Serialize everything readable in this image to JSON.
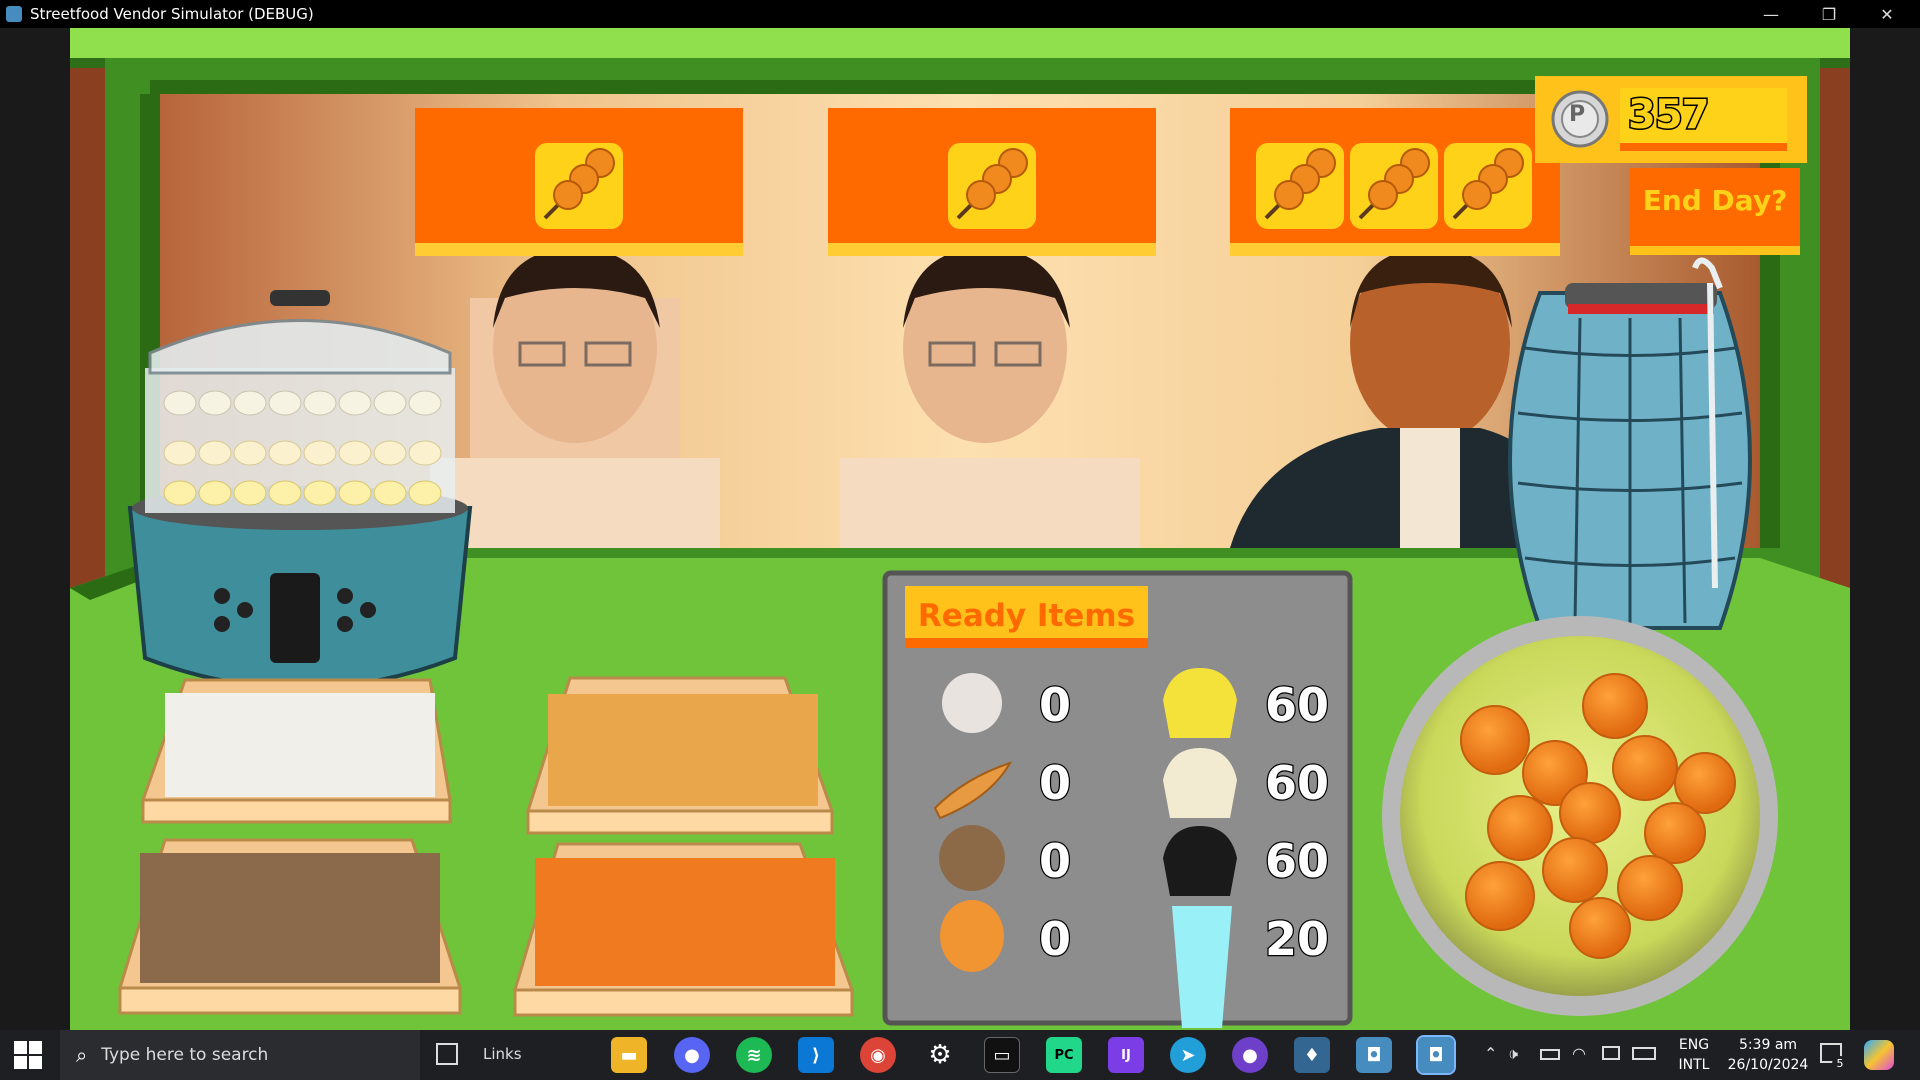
{
  "window": {
    "title": "Streetfood Vendor Simulator (DEBUG)",
    "minimize": "—",
    "maximize": "❐",
    "close": "✕"
  },
  "hud": {
    "coins": "357",
    "coin_symbol": "P",
    "end_day_label": "End Day?"
  },
  "orders": [
    {
      "item": "fishball-skewer",
      "count": 1
    },
    {
      "item": "fishball-skewer",
      "count": 1
    },
    {
      "item": "fishball-skewer",
      "count": 3
    }
  ],
  "ready_items": {
    "title": "Ready Items",
    "left_column": [
      {
        "item": "fishball",
        "count": "0"
      },
      {
        "item": "kikiam",
        "count": "0"
      },
      {
        "item": "squidball",
        "count": "0"
      },
      {
        "item": "kwek-kwek",
        "count": "0"
      }
    ],
    "right_column": [
      {
        "item": "yellow-siomai",
        "count": "60"
      },
      {
        "item": "white-siomai",
        "count": "60"
      },
      {
        "item": "black-siomai",
        "count": "60"
      },
      {
        "item": "drink-cup",
        "count": "20"
      }
    ]
  },
  "colors": {
    "counter_green": "#6fc43a",
    "frame_green": "#3f8f23",
    "order_orange": "#ff6a00",
    "accent_yellow": "#ffd21a",
    "panel_gray": "#8d8d8d"
  },
  "taskbar": {
    "search_placeholder": "Type here to search",
    "links_label": "Links",
    "language": "ENG",
    "keyboard": "INTL",
    "time": "5:39 am",
    "date": "26/10/2024",
    "notifications": "5"
  }
}
